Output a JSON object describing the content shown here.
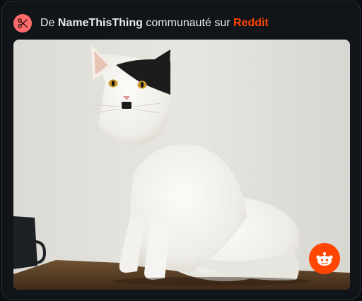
{
  "header": {
    "prefix": "De",
    "community": "NameThisThing",
    "middle": "communauté sur",
    "platform": "Reddit",
    "icon": "community-scissors-icon"
  },
  "media": {
    "badge_icon": "reddit-snoo-icon"
  },
  "colors": {
    "platform": "#ff4500",
    "community_icon_bg": "#ff6b6b",
    "card_bg": "#111418"
  }
}
